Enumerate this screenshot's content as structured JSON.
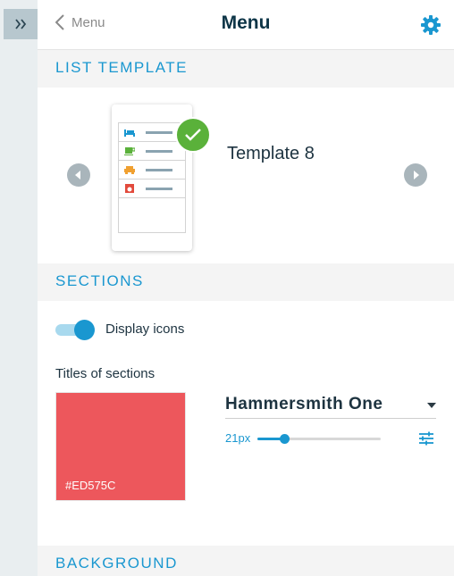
{
  "header": {
    "back_label": "Menu",
    "title": "Menu"
  },
  "sections": {
    "list_template": {
      "title": "LIST TEMPLATE",
      "selected_template": "Template 8"
    },
    "sections": {
      "title": "SECTIONS",
      "display_icons_label": "Display icons",
      "display_icons_on": true,
      "titles_of_sections_label": "Titles of sections",
      "color_hex": "#ED575C",
      "font_name": "Hammersmith One",
      "font_size": "21px",
      "font_size_value": 21,
      "font_size_fraction": 0.22
    },
    "background": {
      "title": "BACKGROUND"
    }
  },
  "colors": {
    "accent": "#1a97d0",
    "title_swatch": "#ED575C",
    "check": "#5ab13a"
  },
  "icons": {
    "rail_toggle": "double-chevron-right-icon",
    "back": "chevron-left-icon",
    "settings": "gear-icon",
    "prev": "arrow-left-icon",
    "next": "arrow-right-icon",
    "selected": "checkmark-icon",
    "font_settings": "sliders-icon"
  }
}
